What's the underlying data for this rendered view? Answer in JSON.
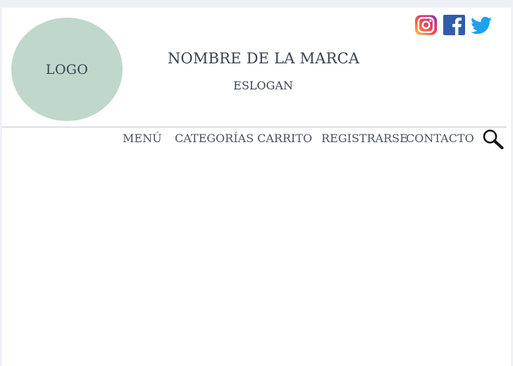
{
  "header": {
    "logo_text": "LOGO",
    "brand_name": "NOMBRE DE LA MARCA",
    "slogan": "ESLOGAN"
  },
  "social": [
    {
      "icon": "instagram-icon"
    },
    {
      "icon": "facebook-icon"
    },
    {
      "icon": "twitter-icon"
    }
  ],
  "nav": {
    "menu": "MENÚ",
    "categories": "CATEGORÍAS",
    "cart": "CARRITO",
    "register": "REGISTRARSE",
    "contact": "CONTACTO"
  },
  "search": {
    "icon": "search-icon"
  },
  "colors": {
    "logo_bg": "#bfd8cb",
    "text": "#3a4350",
    "divider": "#c6c2de",
    "facebook": "#2f5da8",
    "twitter": "#1da1f2"
  }
}
